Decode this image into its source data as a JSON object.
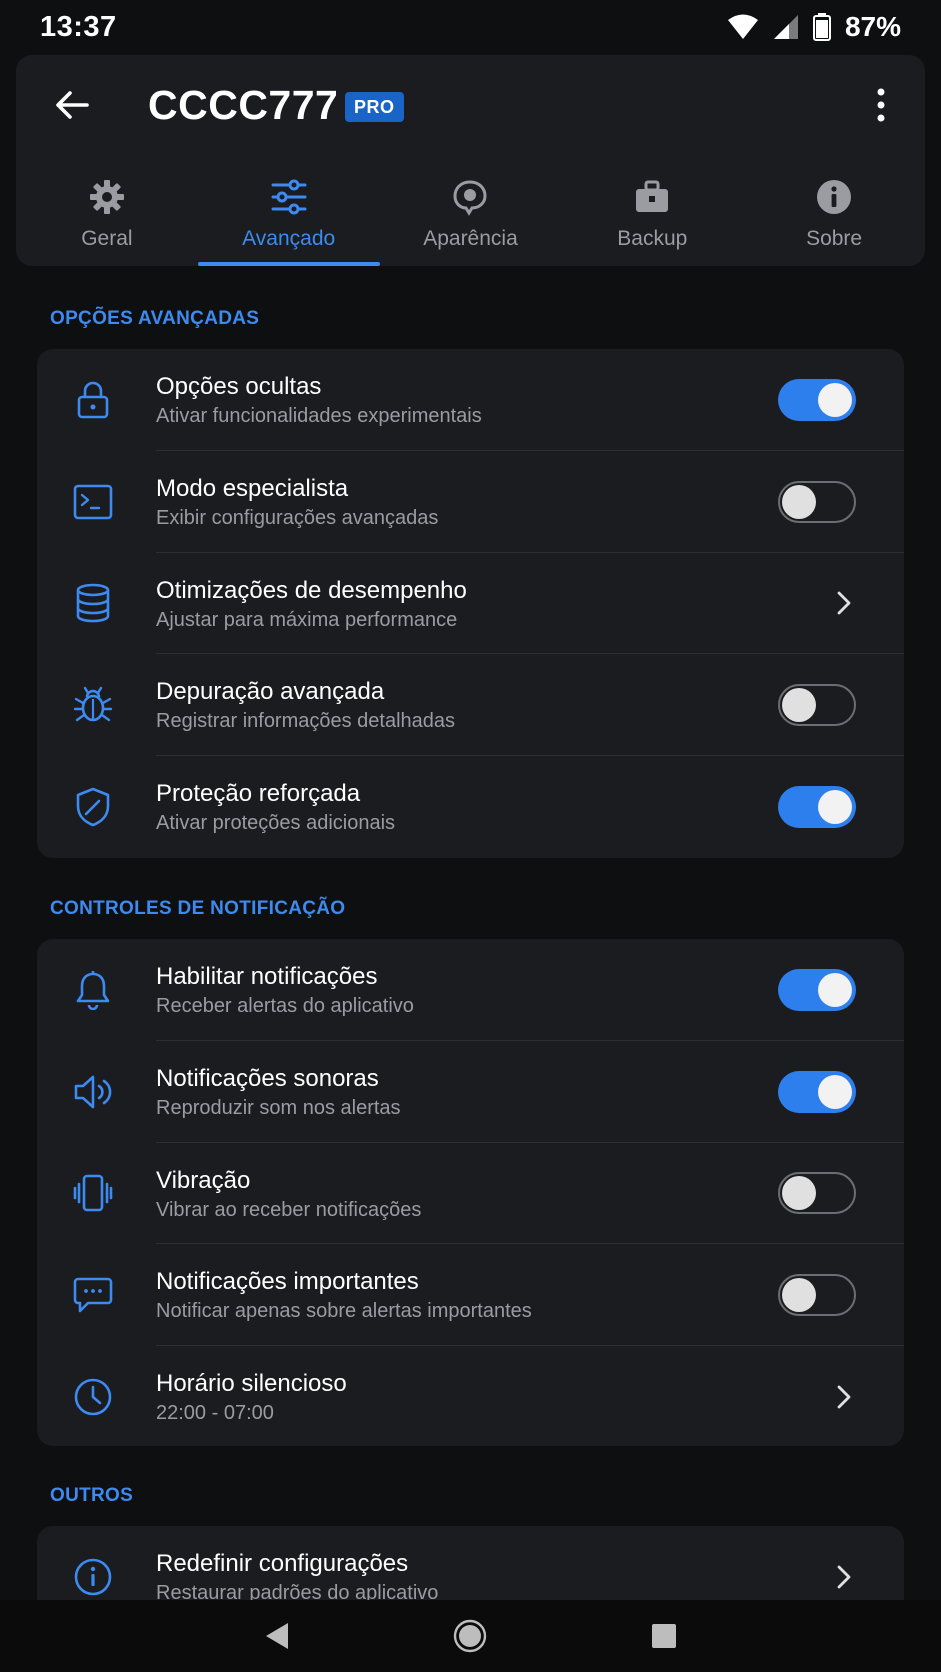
{
  "status_bar": {
    "time": "13:37",
    "battery_percent": "87%"
  },
  "app_bar": {
    "title": "CCCC777",
    "badge": "PRO"
  },
  "tabs": [
    {
      "label": "Geral",
      "icon": "gear-icon",
      "active": false
    },
    {
      "label": "Avançado",
      "icon": "sliders-icon",
      "active": true
    },
    {
      "label": "Aparência",
      "icon": "palette-icon",
      "active": false
    },
    {
      "label": "Backup",
      "icon": "briefcase-icon",
      "active": false
    },
    {
      "label": "Sobre",
      "icon": "info-icon",
      "active": false
    }
  ],
  "sections": {
    "advanced": {
      "header": "OPÇÕES AVANÇADAS",
      "items": [
        {
          "title": "Opções ocultas",
          "subtitle": "Ativar funcionalidades experimentais",
          "icon": "lock-icon",
          "control": "toggle",
          "on": true
        },
        {
          "title": "Modo especialista",
          "subtitle": "Exibir configurações avançadas",
          "icon": "terminal-icon",
          "control": "toggle",
          "on": false
        },
        {
          "title": "Otimizações de desempenho",
          "subtitle": "Ajustar para máxima performance",
          "icon": "database-icon",
          "control": "chevron"
        },
        {
          "title": "Depuração avançada",
          "subtitle": "Registrar informações detalhadas",
          "icon": "bug-icon",
          "control": "toggle",
          "on": false
        },
        {
          "title": "Proteção reforçada",
          "subtitle": "Ativar proteções adicionais",
          "icon": "shield-icon",
          "control": "toggle",
          "on": true
        }
      ]
    },
    "notifications": {
      "header": "CONTROLES DE NOTIFICAÇÃO",
      "items": [
        {
          "title": "Habilitar notificações",
          "subtitle": "Receber alertas do aplicativo",
          "icon": "bell-icon",
          "control": "toggle",
          "on": true
        },
        {
          "title": "Notificações sonoras",
          "subtitle": "Reproduzir som nos alertas",
          "icon": "speaker-icon",
          "control": "toggle",
          "on": true
        },
        {
          "title": "Vibração",
          "subtitle": "Vibrar ao receber notificações",
          "icon": "vibrate-icon",
          "control": "toggle",
          "on": false
        },
        {
          "title": "Notificações importantes",
          "subtitle": "Notificar apenas sobre alertas importantes",
          "icon": "chat-icon",
          "control": "toggle",
          "on": false
        },
        {
          "title": "Horário silencioso",
          "subtitle": "22:00 - 07:00",
          "icon": "clock-icon",
          "control": "chevron"
        }
      ]
    },
    "others": {
      "header": "OUTROS",
      "items": [
        {
          "title": "Redefinir configurações",
          "subtitle": "Restaurar padrões do aplicativo",
          "icon": "info-circle-icon",
          "control": "chevron"
        }
      ]
    }
  },
  "colors": {
    "accent": "#3d8af0",
    "toggle_on": "#2d7fee",
    "background": "#0e0f11",
    "card": "#1b1c1f",
    "secondary_text": "#9a9ca1"
  }
}
